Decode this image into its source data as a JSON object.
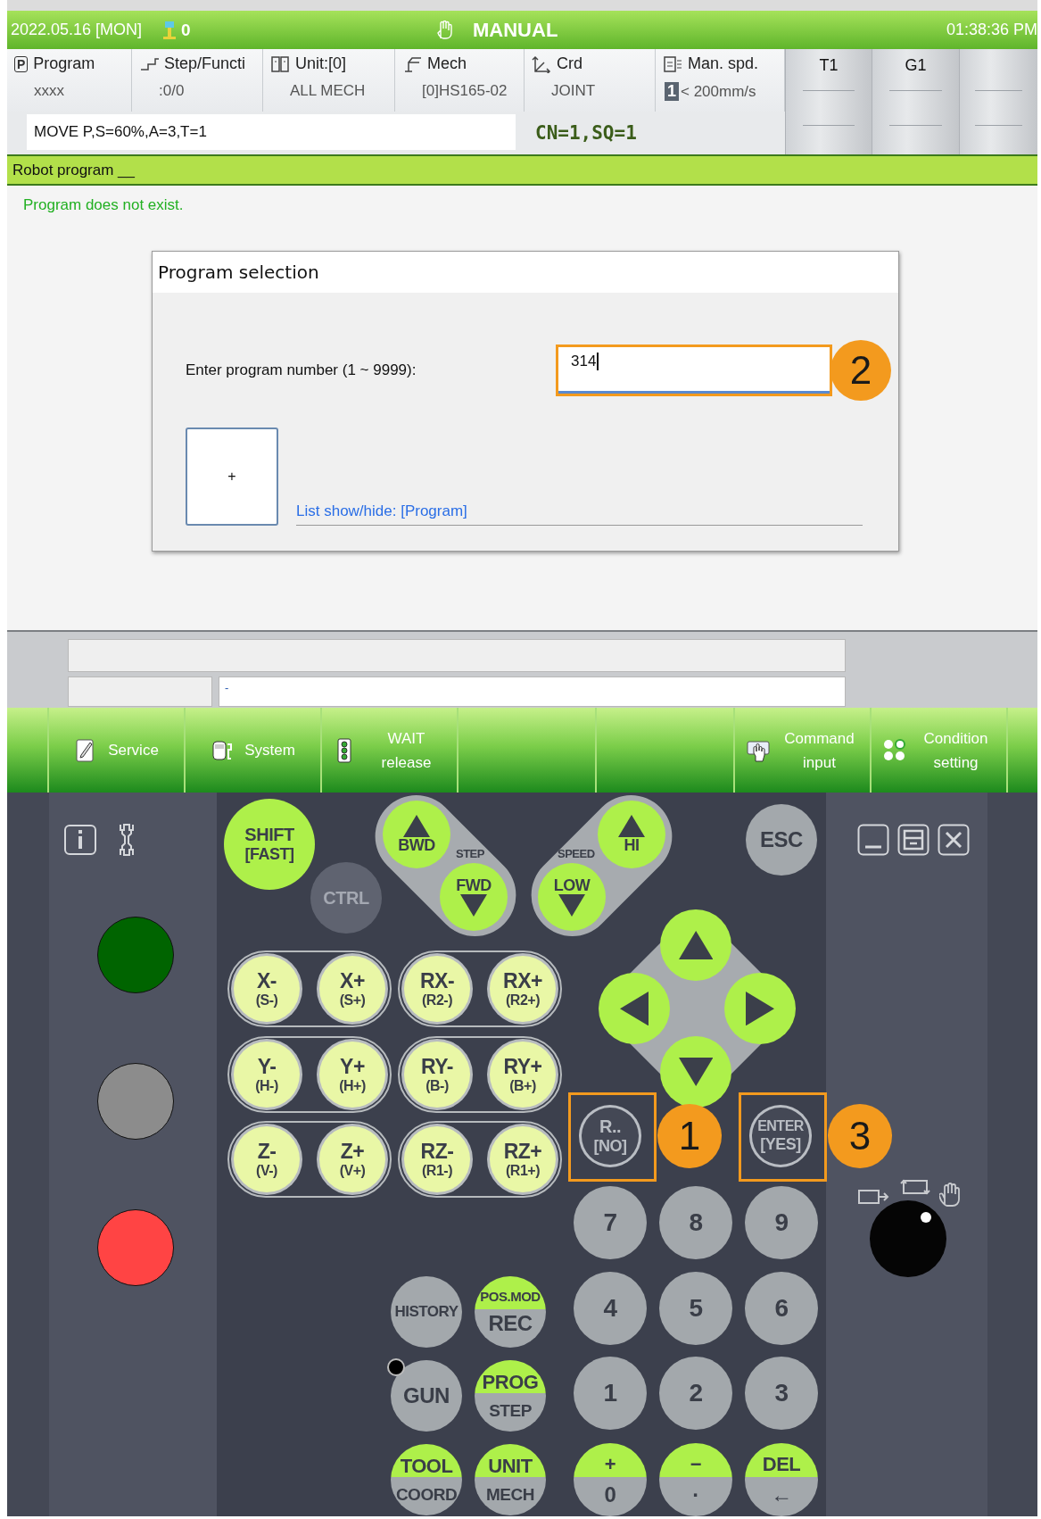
{
  "status_bar": {
    "date": "2022.05.16 [MON]",
    "signal": "0",
    "mode": "MANUAL",
    "time": "01:38:36 PM"
  },
  "info_columns": [
    {
      "label": "Program",
      "value": "xxxx",
      "badge": "P"
    },
    {
      "label": "Step/Functi",
      "value": ":0/0"
    },
    {
      "label": "Unit:[0]",
      "value": "ALL MECH"
    },
    {
      "label": "Mech",
      "value": "[0]HS165-02"
    },
    {
      "label": "Crd",
      "value": "JOINT"
    },
    {
      "label": "Man. spd.",
      "value": "< 200mm/s",
      "badge": "1"
    }
  ],
  "tool_tabs": [
    "T1",
    "G1"
  ],
  "command_line": {
    "text": "MOVE P,S=60%,A=3,T=1",
    "sequence": "CN=1,SQ=1"
  },
  "section_title": "Robot program __",
  "message": "Program does not exist.",
  "dialog": {
    "title": "Program selection",
    "label": "Enter program number (1 ~ 9999):",
    "value": "314",
    "callout": "2",
    "add_button": "+",
    "link": "List show/hide: [Program]"
  },
  "bottom_fields": {
    "value": "-"
  },
  "function_keys": [
    {
      "kind": "key",
      "label": "Service"
    },
    {
      "kind": "key",
      "label": "System"
    },
    {
      "kind": "key",
      "label": "WAIT release"
    },
    {
      "kind": "empty"
    },
    {
      "kind": "empty"
    },
    {
      "kind": "key",
      "label": "Command input"
    },
    {
      "kind": "key",
      "label": "Condition setting"
    }
  ],
  "pendant": {
    "lamps": [
      {
        "color": "#006400"
      },
      {
        "color": "#8c8c8c"
      },
      {
        "color": "#ff4444"
      }
    ],
    "cluster_labels": [
      "STEP",
      "SPEED"
    ],
    "keys": [
      {
        "kind": "green",
        "label": "SHIFT",
        "sub": "[FAST]"
      },
      {
        "kind": "dark",
        "label": "CTRL"
      },
      {
        "kind": "jogup",
        "label": "BWD"
      },
      {
        "kind": "jogdown",
        "label": "FWD"
      },
      {
        "kind": "jogup",
        "label": "HI"
      },
      {
        "kind": "jogdown",
        "label": "LOW"
      },
      {
        "kind": "grey",
        "label": "ESC"
      },
      {
        "kind": "pale",
        "label": "X-",
        "sub": "(S-)"
      },
      {
        "kind": "pale",
        "label": "X+",
        "sub": "(S+)"
      },
      {
        "kind": "pale",
        "label": "RX-",
        "sub": "(R2-)"
      },
      {
        "kind": "pale",
        "label": "RX+",
        "sub": "(R2+)"
      },
      {
        "kind": "pale",
        "label": "Y-",
        "sub": "(H-)"
      },
      {
        "kind": "pale",
        "label": "Y+",
        "sub": "(H+)"
      },
      {
        "kind": "pale",
        "label": "RY-",
        "sub": "(B-)"
      },
      {
        "kind": "pale",
        "label": "RY+",
        "sub": "(B+)"
      },
      {
        "kind": "pale",
        "label": "Z-",
        "sub": "(V-)"
      },
      {
        "kind": "pale",
        "label": "Z+",
        "sub": "(V+)"
      },
      {
        "kind": "pale",
        "label": "RZ-",
        "sub": "(R1-)"
      },
      {
        "kind": "pale",
        "label": "RZ+",
        "sub": "(R1+)"
      },
      {
        "kind": "up"
      },
      {
        "kind": "left"
      },
      {
        "kind": "right"
      },
      {
        "kind": "down"
      },
      {
        "kind": "outline",
        "label": "R..",
        "sub": "[NO]",
        "callout": "1"
      },
      {
        "kind": "outline",
        "label": "ENTER",
        "sub": "[YES]",
        "callout": "3"
      },
      {
        "kind": "grey",
        "label": "7"
      },
      {
        "kind": "grey",
        "label": "8"
      },
      {
        "kind": "grey",
        "label": "9"
      },
      {
        "kind": "grey",
        "label": "HISTORY"
      },
      {
        "kind": "split",
        "label": "POS.MOD",
        "sub": "REC"
      },
      {
        "kind": "grey",
        "label": "4"
      },
      {
        "kind": "grey",
        "label": "5"
      },
      {
        "kind": "grey",
        "label": "6"
      },
      {
        "kind": "grey",
        "label": "GUN"
      },
      {
        "kind": "split",
        "label": "PROG",
        "sub": "STEP"
      },
      {
        "kind": "grey",
        "label": "1"
      },
      {
        "kind": "grey",
        "label": "2"
      },
      {
        "kind": "grey",
        "label": "3"
      },
      {
        "kind": "split",
        "label": "TOOL",
        "sub": "COORD"
      },
      {
        "kind": "split",
        "label": "UNIT",
        "sub": "MECH"
      },
      {
        "kind": "split",
        "label": "+",
        "sub": "0"
      },
      {
        "kind": "split",
        "label": "−",
        "sub": "·"
      },
      {
        "kind": "split",
        "label": "DEL",
        "sub": "←"
      }
    ]
  }
}
